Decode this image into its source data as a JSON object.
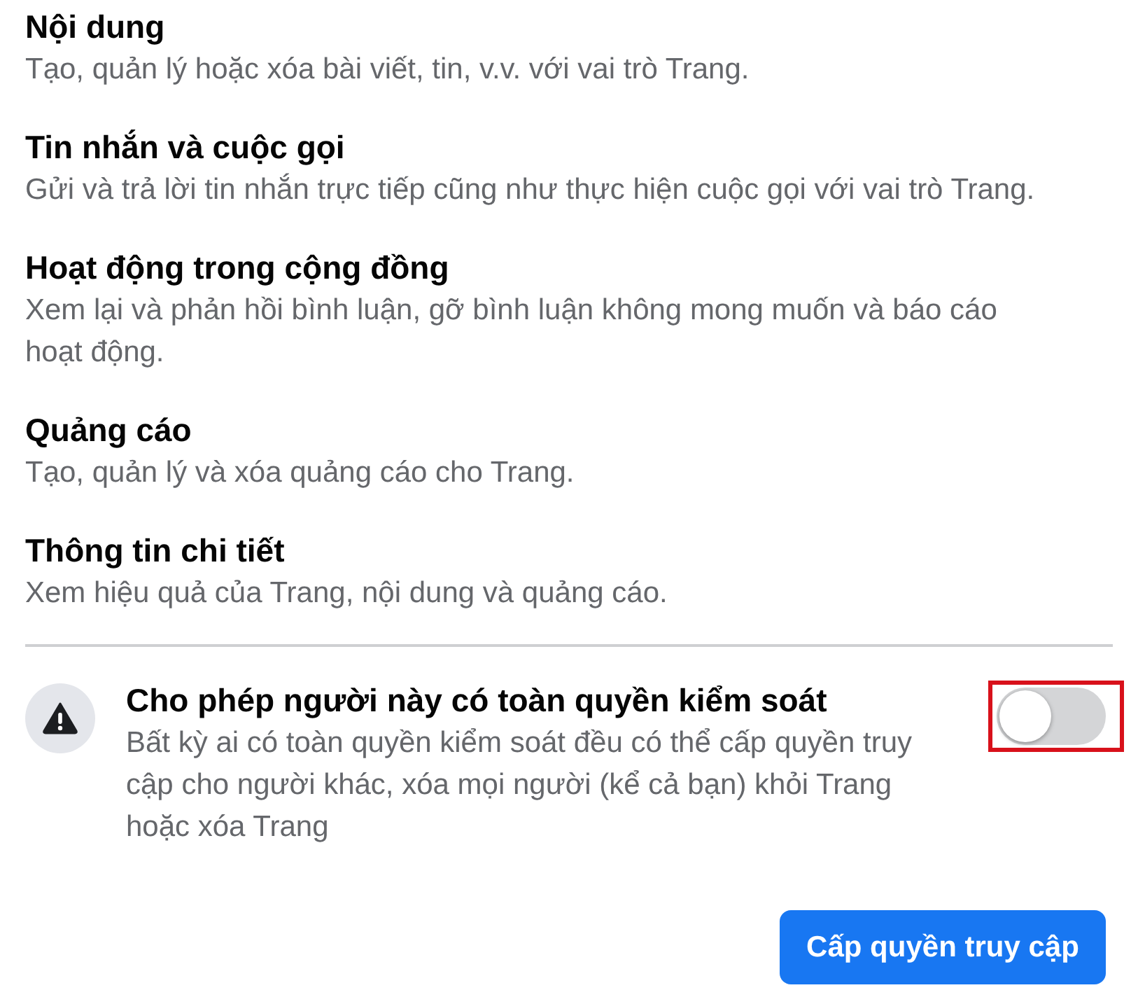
{
  "sections": [
    {
      "title": "Nội dung",
      "description": "Tạo, quản lý hoặc xóa bài viết, tin, v.v. với vai trò Trang."
    },
    {
      "title": "Tin nhắn và cuộc gọi",
      "description": "Gửi và trả lời tin nhắn trực tiếp cũng như thực hiện cuộc gọi với vai trò Trang."
    },
    {
      "title": "Hoạt động trong cộng đồng",
      "description": "Xem lại và phản hồi bình luận, gỡ bình luận không mong muốn và báo cáo hoạt động."
    },
    {
      "title": "Quảng cáo",
      "description": "Tạo, quản lý và xóa quảng cáo cho Trang."
    },
    {
      "title": "Thông tin chi tiết",
      "description": "Xem hiệu quả của Trang, nội dung và quảng cáo."
    }
  ],
  "full_control": {
    "title": "Cho phép người này có toàn quyền kiểm soát",
    "description": "Bất kỳ ai có toàn quyền kiểm soát đều có thể cấp quyền truy cập cho người khác, xóa mọi người (kể cả bạn) khỏi Trang hoặc xóa Trang",
    "on": false,
    "highlighted": true
  },
  "button": {
    "label": "Cấp quyền truy cập"
  }
}
